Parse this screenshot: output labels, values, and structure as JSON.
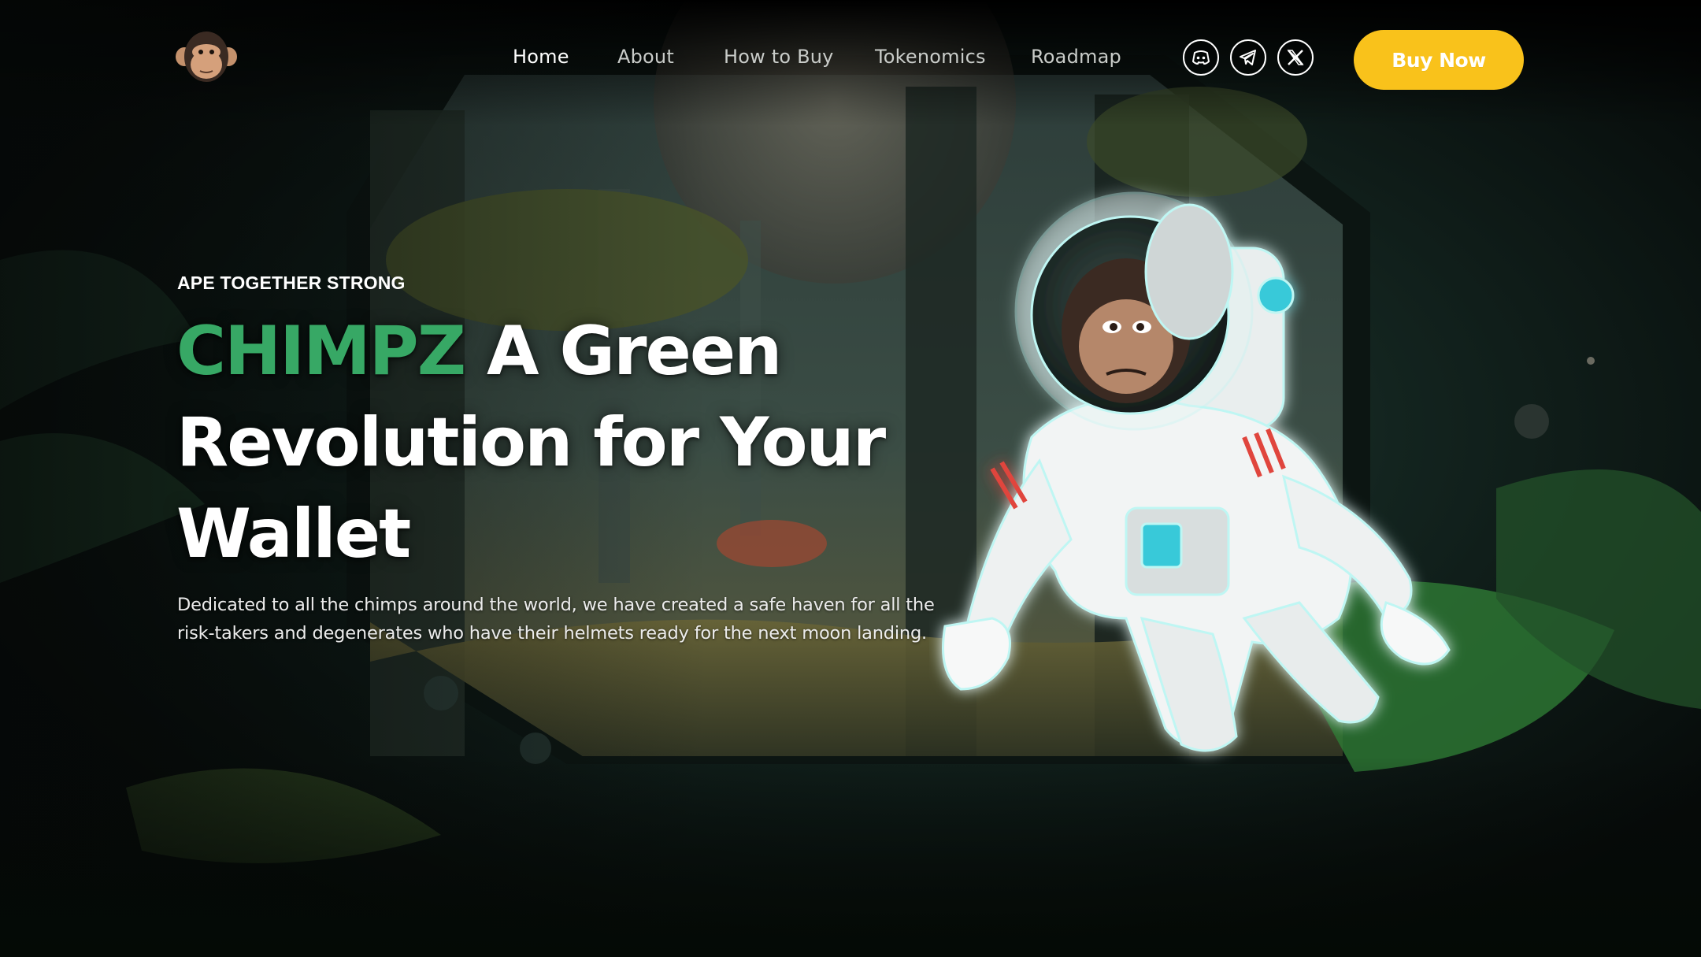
{
  "brand": {
    "logo_icon": "chimp-head-logo-icon"
  },
  "nav": {
    "items": [
      {
        "label": "Home",
        "active": true
      },
      {
        "label": "About",
        "active": false
      },
      {
        "label": "How to Buy",
        "active": false
      },
      {
        "label": "Tokenomics",
        "active": false
      },
      {
        "label": "Roadmap",
        "active": false
      }
    ],
    "socials": [
      {
        "icon": "discord-icon"
      },
      {
        "icon": "telegram-icon"
      },
      {
        "icon": "x-twitter-icon"
      }
    ],
    "buy_label": "Buy Now"
  },
  "hero": {
    "eyebrow": "APE TOGETHER STRONG",
    "headline_brand": "CHIMPZ",
    "headline_rest": " A Green Revolution for Your Wallet",
    "description": "Dedicated to all the chimps around the world, we have created a safe haven for all the risk-takers and degenerates who have their helmets ready for the next moon landing.",
    "mascot_icon": "astronaut-chimp-mascot"
  },
  "colors": {
    "accent_green": "#37a865",
    "button_yellow": "#f9c21b",
    "nav_text": "#c9ccc9",
    "background": "#050807"
  }
}
